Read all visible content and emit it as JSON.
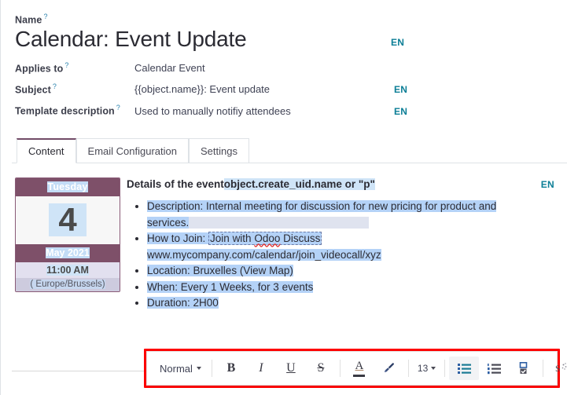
{
  "form": {
    "name_label": "Name",
    "help_glyph": "?",
    "title": "Calendar: Event Update",
    "title_lang": "EN",
    "fields": [
      {
        "label": "Applies to",
        "value": "Calendar Event",
        "lang": ""
      },
      {
        "label": "Subject",
        "value": "{{object.name}}: Event update",
        "lang": "EN"
      },
      {
        "label": "Template description",
        "value": "Used to manually notifiy attendees",
        "lang": "EN"
      }
    ]
  },
  "notebook": {
    "tabs": [
      {
        "label": "Content",
        "active": true
      },
      {
        "label": "Email Configuration",
        "active": false
      },
      {
        "label": "Settings",
        "active": false
      }
    ]
  },
  "calendar": {
    "day_of_week": "Tuesday",
    "day_number": "4",
    "month_year": "May 2021",
    "time": "11:00 AM",
    "timezone": "( Europe/Brussels)"
  },
  "content": {
    "lang_badge": "EN",
    "heading_prefix": "Details of the event",
    "heading_highlight": "object.create_uid.name or \"p\"",
    "bullets": [
      {
        "prefix": "Description: Internal meeting for discussion for new pricing for product and",
        "continuation": "services."
      },
      {
        "prefix": "How to Join: ",
        "boxed": "Join with Odoo Discuss",
        "spell_word": "Odoo",
        "continuation": "www.mycompany.com/calendar/join_videocall/xyz"
      },
      {
        "prefix": "Location: Bruxelles (View Map)"
      },
      {
        "prefix": "When: Every 1 Weeks, for 3 events"
      },
      {
        "prefix": "Duration: 2H00"
      }
    ]
  },
  "toolbar": {
    "style_label": "Normal",
    "bold_label": "B",
    "italic_label": "I",
    "underline_label": "U",
    "strike_label": "S",
    "font_color_letter": "A",
    "font_size_label": "13",
    "highlight_color": "#ff0000",
    "icons": {
      "brush": "brush-icon",
      "bulleted_list": "bulleted-list-icon",
      "numbered_list": "numbered-list-icon",
      "checklist": "checklist-icon",
      "clear_format": "clear-formatting-icon",
      "code_view": "code-view-icon"
    }
  }
}
